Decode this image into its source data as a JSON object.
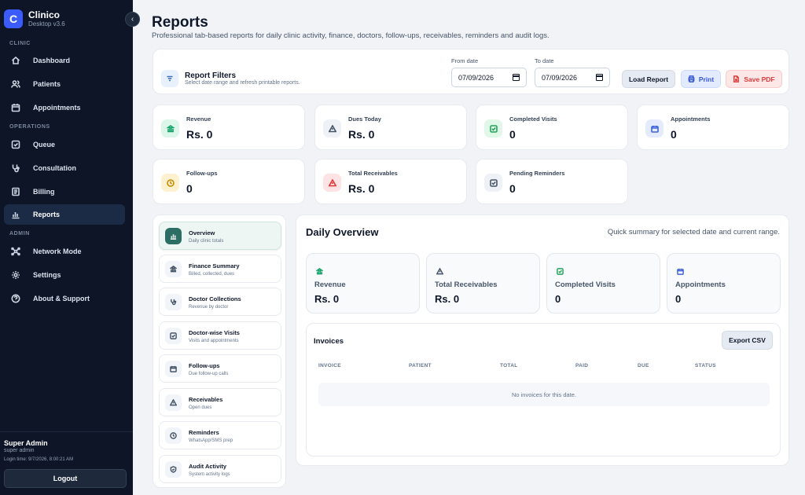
{
  "app": {
    "logo_letter": "C",
    "name": "Clinico",
    "version": "Desktop v3.6",
    "collapse_glyph": "‹"
  },
  "sidebar": {
    "sections": {
      "clinic": "CLINIC",
      "operations": "OPERATIONS",
      "admin": "ADMIN"
    },
    "items": [
      {
        "label": "Dashboard",
        "icon": "home-icon"
      },
      {
        "label": "Patients",
        "icon": "users-icon"
      },
      {
        "label": "Appointments",
        "icon": "calendar-icon"
      },
      {
        "label": "Queue",
        "icon": "checkbox-icon"
      },
      {
        "label": "Consultation",
        "icon": "stethoscope-icon"
      },
      {
        "label": "Billing",
        "icon": "receipt-icon"
      },
      {
        "label": "Reports",
        "icon": "bar-chart-icon",
        "active": true
      },
      {
        "label": "Network Mode",
        "icon": "network-icon"
      },
      {
        "label": "Settings",
        "icon": "gear-icon"
      },
      {
        "label": "About & Support",
        "icon": "help-icon"
      }
    ],
    "user": {
      "name": "Super Admin",
      "role": "super admin",
      "login_time": "Login time: 9/7/2026, 8:00:21 AM"
    },
    "logout_label": "Logout"
  },
  "header": {
    "title": "Reports",
    "subtitle": "Professional tab-based reports for daily clinic activity, finance, doctors, follow-ups, receivables, reminders and audit logs."
  },
  "filters": {
    "title": "Report Filters",
    "subtitle": "Select date range and refresh printable reports.",
    "from_label": "From date",
    "from_value": "07/09/2026",
    "to_label": "To date",
    "to_value": "07/09/2026",
    "load_label": "Load Report",
    "print_label": "Print",
    "pdf_label": "Save PDF"
  },
  "stats": [
    {
      "label": "Revenue",
      "value": "Rs. 0",
      "icon": "bank-icon",
      "color": "#16a36a",
      "bg": "#dcf7ea"
    },
    {
      "label": "Dues Today",
      "value": "Rs. 0",
      "icon": "warning-icon",
      "color": "#475569",
      "bg": "#eef1f6"
    },
    {
      "label": "Completed Visits",
      "value": "0",
      "icon": "check-square-icon",
      "color": "#22a45b",
      "bg": "#e1f7e7"
    },
    {
      "label": "Appointments",
      "value": "0",
      "icon": "calendar-icon",
      "color": "#3f63d8",
      "bg": "#e4ebfd"
    },
    {
      "label": "Follow-ups",
      "value": "0",
      "icon": "clock-icon",
      "color": "#c98a06",
      "bg": "#fdf1cf"
    },
    {
      "label": "Total Receivables",
      "value": "Rs. 0",
      "icon": "warning-icon",
      "color": "#dc3a3a",
      "bg": "#fde3e3"
    },
    {
      "label": "Pending Reminders",
      "value": "0",
      "icon": "check-square-icon",
      "color": "#475569",
      "bg": "#eef1f6"
    }
  ],
  "tabs": [
    {
      "title": "Overview",
      "sub": "Daily clinic totals",
      "icon": "bar-chart-icon",
      "active": true
    },
    {
      "title": "Finance Summary",
      "sub": "Billed, collected, dues",
      "icon": "bank-icon"
    },
    {
      "title": "Doctor Collections",
      "sub": "Revenue by doctor",
      "icon": "stethoscope-icon"
    },
    {
      "title": "Doctor-wise Visits",
      "sub": "Visits and appointments",
      "icon": "check-square-icon"
    },
    {
      "title": "Follow-ups",
      "sub": "Due follow-up calls",
      "icon": "calendar-icon"
    },
    {
      "title": "Receivables",
      "sub": "Open dues",
      "icon": "warning-icon"
    },
    {
      "title": "Reminders",
      "sub": "WhatsApp/SMS prep",
      "icon": "clock-icon"
    },
    {
      "title": "Audit Activity",
      "sub": "System activity logs",
      "icon": "shield-icon"
    }
  ],
  "overview": {
    "title": "Daily Overview",
    "subtitle": "Quick summary for selected date and current range.",
    "cards": [
      {
        "label": "Revenue",
        "value": "Rs. 0",
        "icon": "bank-icon",
        "color": "#16a36a"
      },
      {
        "label": "Total Receivables",
        "value": "Rs. 0",
        "icon": "warning-icon",
        "color": "#475569"
      },
      {
        "label": "Completed Visits",
        "value": "0",
        "icon": "check-square-icon",
        "color": "#22a45b"
      },
      {
        "label": "Appointments",
        "value": "0",
        "icon": "calendar-icon",
        "color": "#3f63d8"
      }
    ],
    "invoices": {
      "title": "Invoices",
      "export_label": "Export CSV",
      "columns": [
        "INVOICE",
        "PATIENT",
        "TOTAL",
        "PAID",
        "DUE",
        "STATUS"
      ],
      "empty": "No invoices for this date."
    }
  }
}
